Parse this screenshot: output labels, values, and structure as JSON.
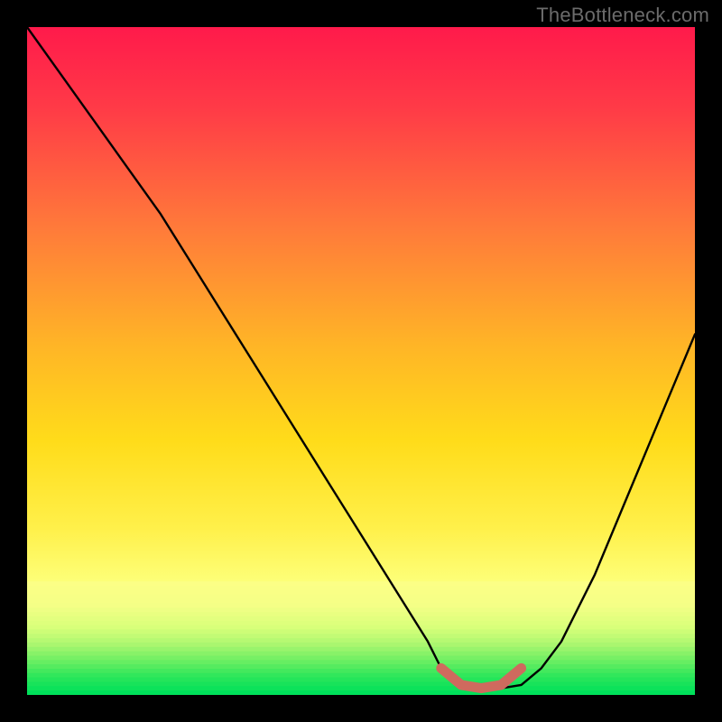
{
  "attribution": "TheBottleneck.com",
  "chart_data": {
    "type": "line",
    "title": "",
    "xlabel": "",
    "ylabel": "",
    "xlim": [
      0,
      100
    ],
    "ylim": [
      0,
      100
    ],
    "grid": false,
    "legend": false,
    "series": [
      {
        "name": "bottleneck-curve",
        "x": [
          0,
          5,
          10,
          15,
          20,
          25,
          30,
          35,
          40,
          45,
          50,
          55,
          60,
          62,
          65,
          68,
          71,
          74,
          77,
          80,
          85,
          90,
          95,
          100
        ],
        "values": [
          100,
          93,
          86,
          79,
          72,
          64,
          56,
          48,
          40,
          32,
          24,
          16,
          8,
          4,
          1.5,
          1,
          1,
          1.5,
          4,
          8,
          18,
          30,
          42,
          54
        ]
      },
      {
        "name": "highlight-band",
        "x": [
          62,
          65,
          68,
          71,
          74
        ],
        "values": [
          4,
          1.5,
          1,
          1.5,
          4
        ]
      }
    ],
    "optimum_range_pct": [
      62,
      74
    ],
    "colors": {
      "curve": "#000000",
      "highlight": "#cf6a5e",
      "gradient_top": "#ff1a4b",
      "gradient_mid": "#ffd400",
      "gradient_low": "#f6ff7a",
      "gradient_bottom": "#00e05a"
    }
  }
}
